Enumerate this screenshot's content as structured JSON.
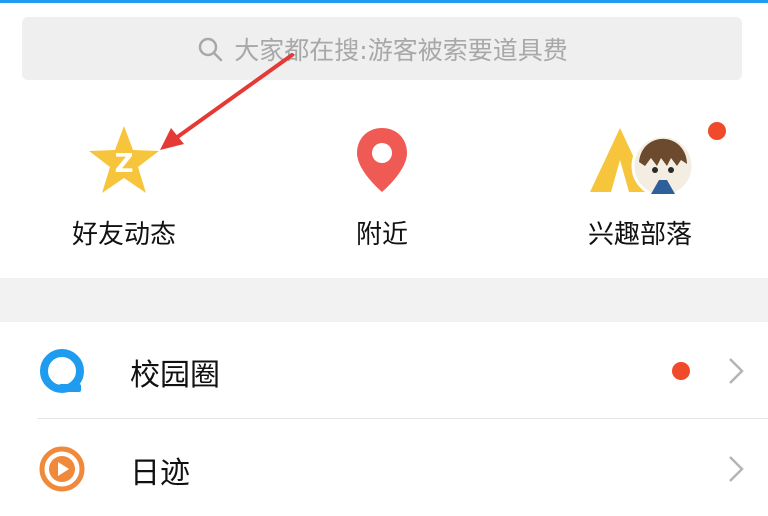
{
  "search": {
    "placeholder": "大家都在搜:游客被索要道具费"
  },
  "grid": [
    {
      "label": "好友动态",
      "icon": "star-q-icon"
    },
    {
      "label": "附近",
      "icon": "location-pin-icon"
    },
    {
      "label": "兴趣部落",
      "icon": "tent-avatar-icon"
    }
  ],
  "list": [
    {
      "label": "校园圈",
      "icon": "campus-q-icon",
      "has_dot": true
    },
    {
      "label": "日迹",
      "icon": "play-circle-icon",
      "has_dot": false
    }
  ],
  "colors": {
    "accent_blue": "#1f9cf0",
    "star_yellow": "#f7c53b",
    "pin_red": "#f05a54",
    "badge_red": "#f04a2b",
    "play_orange": "#f08a3a"
  }
}
